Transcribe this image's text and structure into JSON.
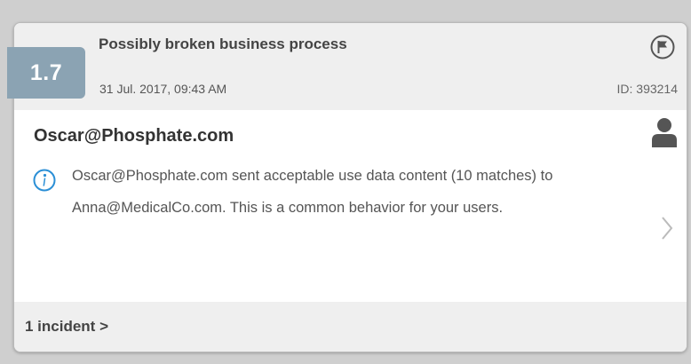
{
  "alert": {
    "title": "Possibly broken business process",
    "date": "31 Jul. 2017, 09:43 AM",
    "id_label": "ID: 393214",
    "score": "1.7",
    "flag_icon": "flag-icon"
  },
  "detail": {
    "email": "Oscar@Phosphate.com",
    "person_icon": "person-icon",
    "info_icon": "info-icon",
    "description": "Oscar@Phosphate.com sent acceptable use data content (10 matches) to Anna@MedicalCo.com. This is a common behavior for your users.",
    "chevron_icon": "chevron-right-icon"
  },
  "footer": {
    "incidents_label": "1 incident >"
  },
  "colors": {
    "badge": "#8ba3b3",
    "info_icon": "#2b8fd6",
    "card_bg": "#efefef",
    "body_bg": "#ffffff"
  }
}
